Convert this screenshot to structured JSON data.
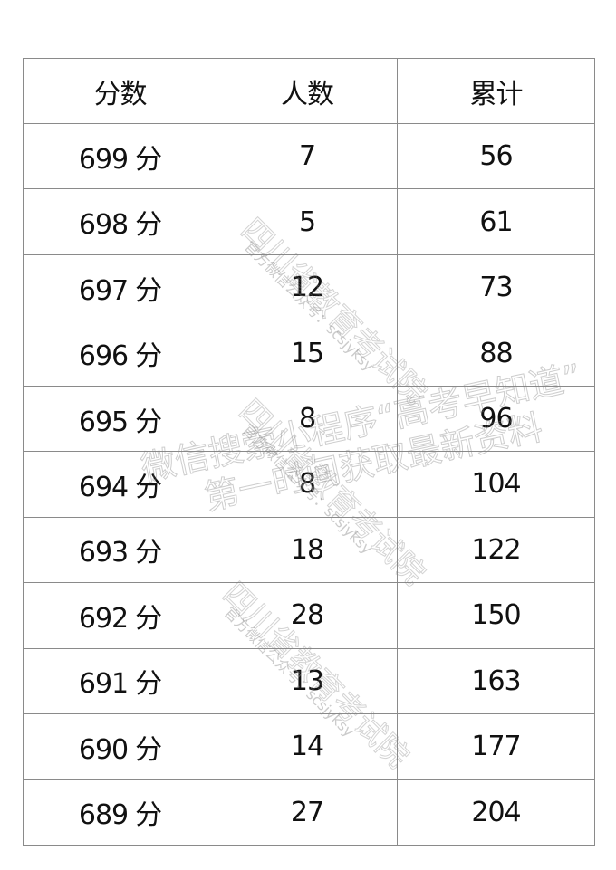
{
  "table": {
    "headers": [
      "分数",
      "人数",
      "累计"
    ],
    "score_unit": "分",
    "rows": [
      {
        "score": "699",
        "count": "7",
        "cumulative": "56"
      },
      {
        "score": "698",
        "count": "5",
        "cumulative": "61"
      },
      {
        "score": "697",
        "count": "12",
        "cumulative": "73"
      },
      {
        "score": "696",
        "count": "15",
        "cumulative": "88"
      },
      {
        "score": "695",
        "count": "8",
        "cumulative": "96"
      },
      {
        "score": "694",
        "count": "8",
        "cumulative": "104"
      },
      {
        "score": "693",
        "count": "18",
        "cumulative": "122"
      },
      {
        "score": "692",
        "count": "28",
        "cumulative": "150"
      },
      {
        "score": "691",
        "count": "13",
        "cumulative": "163"
      },
      {
        "score": "690",
        "count": "14",
        "cumulative": "177"
      },
      {
        "score": "689",
        "count": "27",
        "cumulative": "204"
      }
    ]
  },
  "watermark": {
    "org_name": "四川省教育考试院",
    "org_sub": "官方微信公众号：scsjyksy",
    "line1": "微信搜索小程序“高考早知道”",
    "line2": "第一时间获取最新资料"
  }
}
